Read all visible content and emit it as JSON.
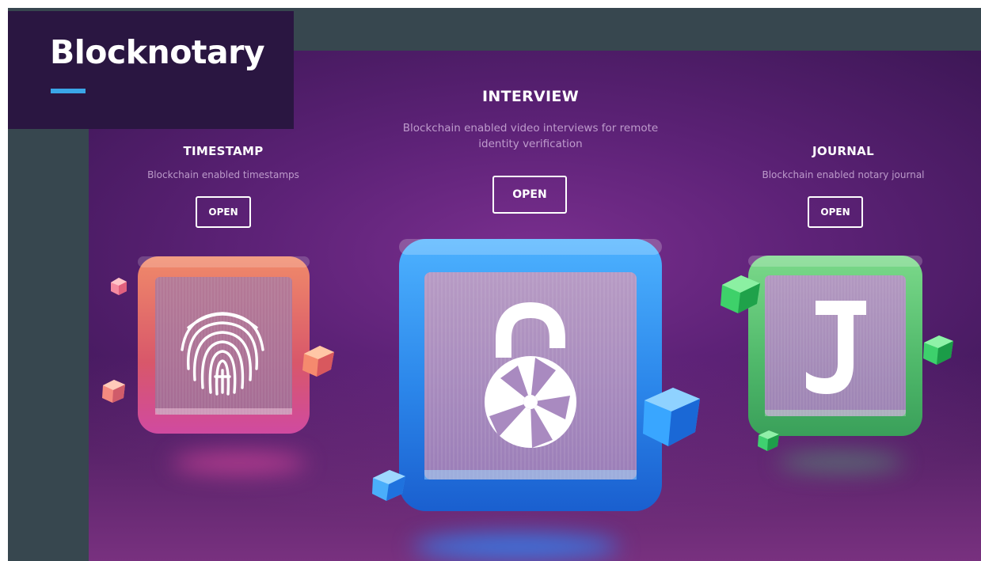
{
  "brand": {
    "title": "Blocknotary"
  },
  "cards": [
    {
      "title": "TIMESTAMP",
      "description": "Blockchain enabled timestamps",
      "button": "OPEN",
      "icon": "fingerprint-icon"
    },
    {
      "title": "INTERVIEW",
      "description": "Blockchain enabled video interviews for remote identity verification",
      "button": "OPEN",
      "icon": "camera-lock-icon"
    },
    {
      "title": "JOURNAL",
      "description": "Blockchain enabled notary journal",
      "button": "OPEN",
      "icon": "letter-j-icon"
    }
  ],
  "colors": {
    "accent_underline": "#3aa6e8",
    "timestamp_tile": "#e0705f",
    "interview_tile": "#2e8ff0",
    "journal_tile": "#5cc27a",
    "background_purple": "#5d2277",
    "slate": "#37474f"
  }
}
